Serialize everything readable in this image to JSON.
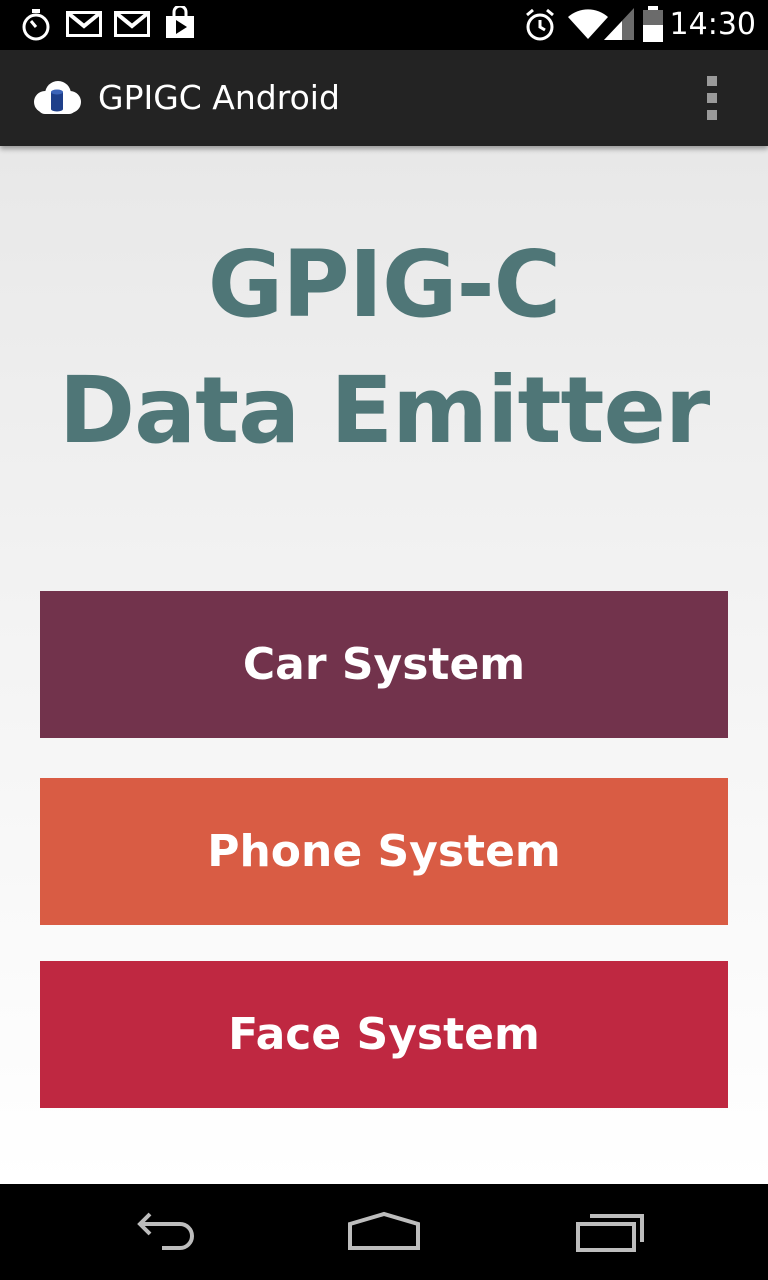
{
  "status_bar": {
    "time": "14:30",
    "left_icons": [
      "stopwatch-icon",
      "gmail-icon",
      "gmail-icon",
      "play-store-icon"
    ],
    "right_icons": [
      "alarm-icon",
      "wifi-icon",
      "signal-icon",
      "battery-icon"
    ]
  },
  "action_bar": {
    "title": "GPIGC Android",
    "logo_icon": "cloud-database-icon",
    "overflow_icon": "overflow-menu-icon"
  },
  "main": {
    "heading_line1": "GPIG-C",
    "heading_line2": "Data Emitter",
    "buttons": [
      {
        "label": "Car System",
        "color": "#72334c"
      },
      {
        "label": "Phone System",
        "color": "#d95c44"
      },
      {
        "label": "Face System",
        "color": "#bf2841"
      }
    ]
  },
  "nav_bar": {
    "icons": [
      "back-icon",
      "home-icon",
      "recents-icon"
    ]
  },
  "colors": {
    "heading": "#4f7677",
    "action_bar": "#232323",
    "status_bar": "#000000"
  }
}
